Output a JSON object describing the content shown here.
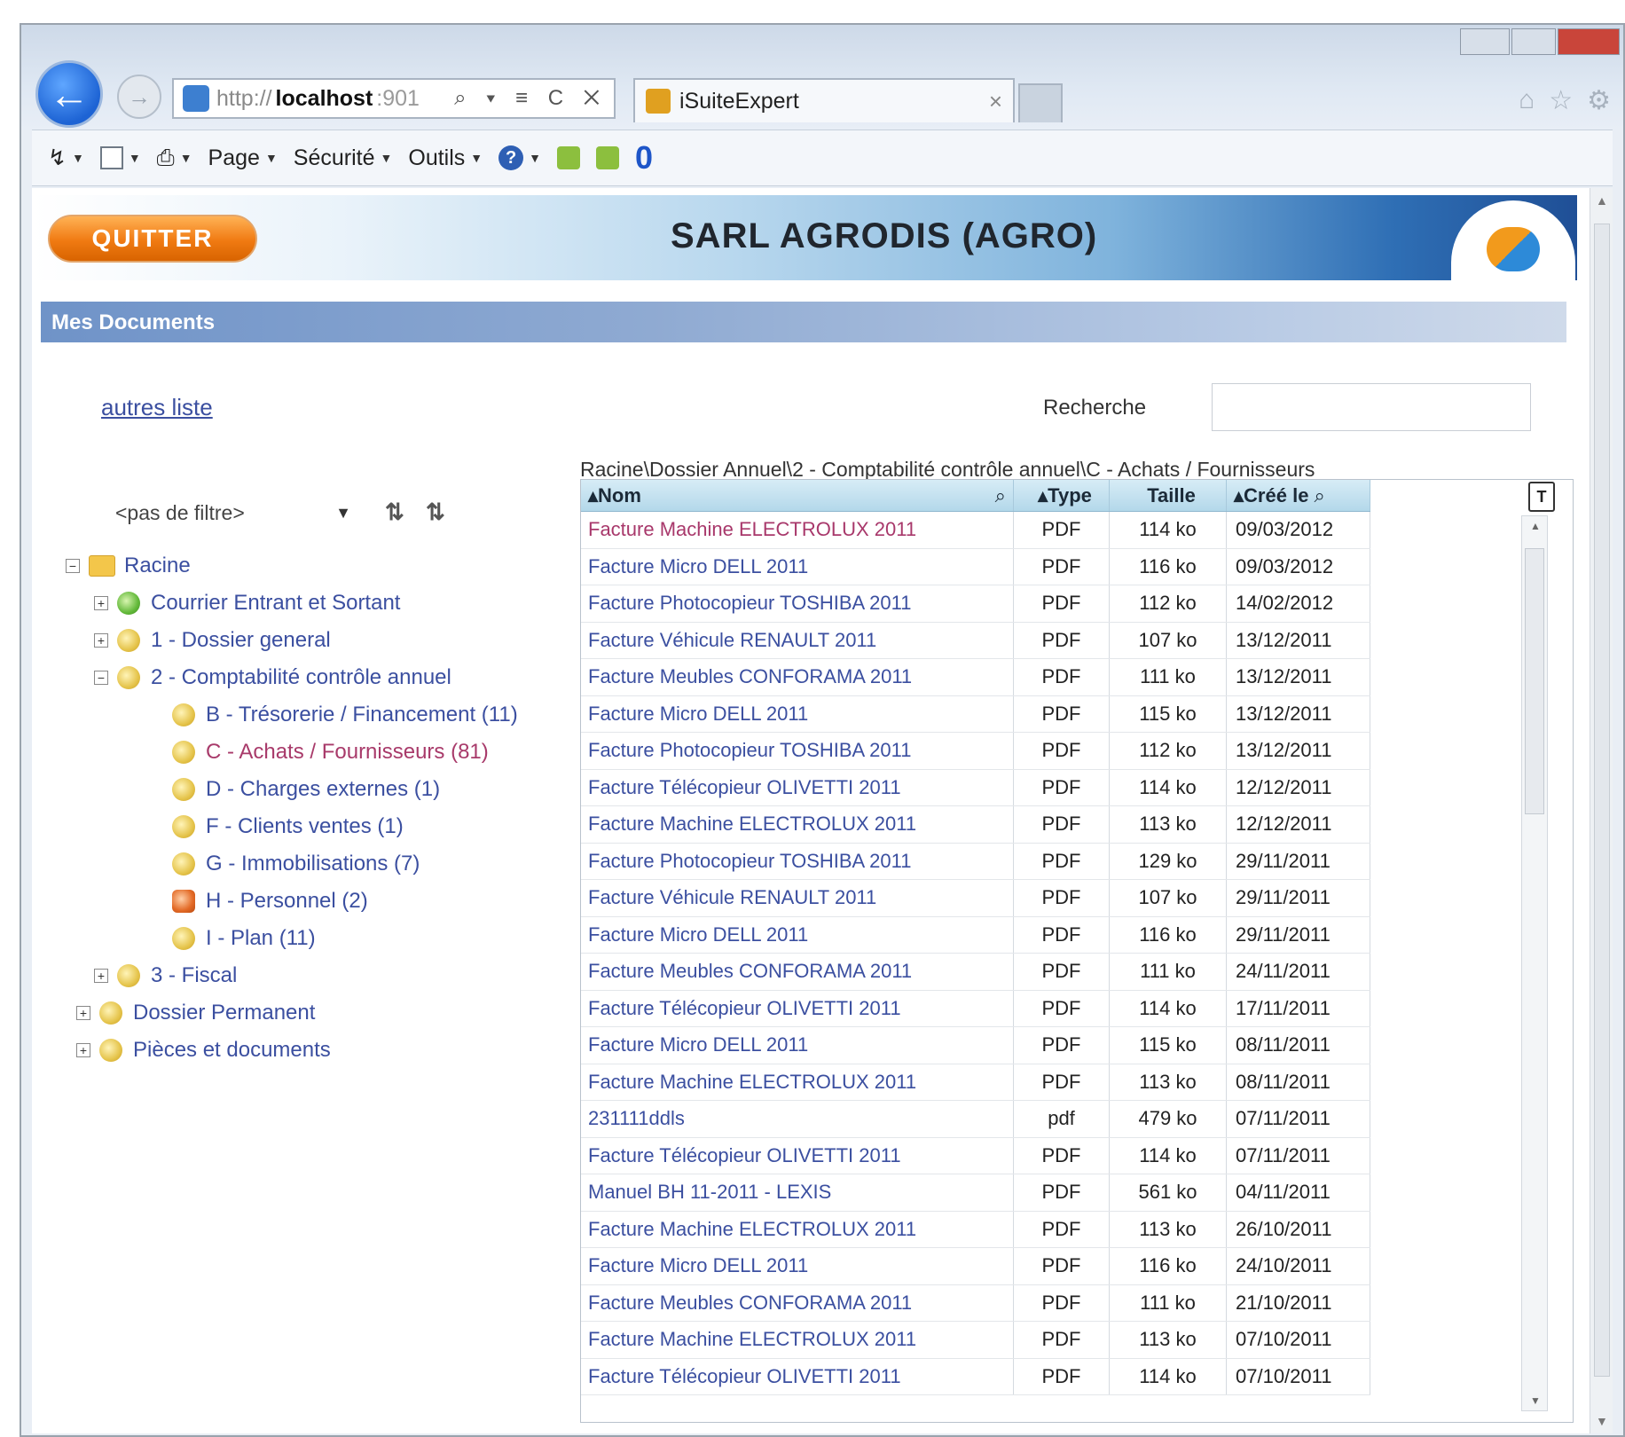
{
  "browser": {
    "url_proto": "http://",
    "url_host": "localhost",
    "url_tail": ":901",
    "address_icons": "⌕ ▾ ≡ C ✕",
    "tab_title": "iSuiteExpert",
    "tab_close": "×",
    "back_glyph": "←"
  },
  "commandbar": {
    "page_menu": "Page",
    "security_menu": "Sécurité",
    "tools_menu": "Outils",
    "caret": "▼",
    "help_glyph": "?",
    "blue_glyph": "0"
  },
  "app": {
    "quit_button": "QUITTER",
    "company_name": "SARL AGRODIS (AGRO)",
    "section_title": "Mes Documents",
    "back_link": "autres liste",
    "search_label": "Recherche",
    "search_value": "",
    "breadcrumb": "Racine\\Dossier Annuel\\2 - Comptabilité contrôle annuel\\C - Achats / Fournisseurs"
  },
  "tree": {
    "filter_value": "<pas de filtre>",
    "filter_caret": "▼",
    "tool_1": "⇅",
    "tool_2": "⇅",
    "nodes": [
      {
        "label": "Racine",
        "toggle": "−"
      },
      {
        "label": "Courrier Entrant et Sortant",
        "toggle": "+"
      },
      {
        "label": "1 - Dossier general",
        "toggle": "+"
      },
      {
        "label": "2 - Comptabilité contrôle annuel",
        "toggle": "−"
      },
      {
        "label": "B - Trésorerie / Financement (11)",
        "toggle": ""
      },
      {
        "label": "C - Achats / Fournisseurs (81)",
        "toggle": ""
      },
      {
        "label": "D - Charges externes (1)",
        "toggle": ""
      },
      {
        "label": "F - Clients ventes (1)",
        "toggle": ""
      },
      {
        "label": "G - Immobilisations (7)",
        "toggle": ""
      },
      {
        "label": "H - Personnel (2)",
        "toggle": ""
      },
      {
        "label": "I - Plan (11)",
        "toggle": ""
      },
      {
        "label": "3 - Fiscal",
        "toggle": "+"
      },
      {
        "label": "Dossier Permanent",
        "toggle": "+"
      },
      {
        "label": "Pièces et documents",
        "toggle": "+"
      }
    ]
  },
  "grid": {
    "columns": [
      "▴Nom",
      "▴Type",
      "Taille",
      "▴Créé le"
    ],
    "clear_filter": "T",
    "rows": [
      {
        "name": "Facture Machine ELECTROLUX 2011",
        "type": "PDF",
        "size": "114 ko",
        "date": "09/03/2012"
      },
      {
        "name": "Facture Micro DELL 2011",
        "type": "PDF",
        "size": "116 ko",
        "date": "09/03/2012"
      },
      {
        "name": "Facture Photocopieur TOSHIBA 2011",
        "type": "PDF",
        "size": "112 ko",
        "date": "14/02/2012"
      },
      {
        "name": "Facture Véhicule RENAULT 2011",
        "type": "PDF",
        "size": "107 ko",
        "date": "13/12/2011"
      },
      {
        "name": "Facture Meubles CONFORAMA 2011",
        "type": "PDF",
        "size": "111 ko",
        "date": "13/12/2011"
      },
      {
        "name": "Facture Micro DELL 2011",
        "type": "PDF",
        "size": "115 ko",
        "date": "13/12/2011"
      },
      {
        "name": "Facture Photocopieur TOSHIBA 2011",
        "type": "PDF",
        "size": "112 ko",
        "date": "13/12/2011"
      },
      {
        "name": "Facture Télécopieur OLIVETTI 2011",
        "type": "PDF",
        "size": "114 ko",
        "date": "12/12/2011"
      },
      {
        "name": "Facture Machine ELECTROLUX 2011",
        "type": "PDF",
        "size": "113 ko",
        "date": "12/12/2011"
      },
      {
        "name": "Facture Photocopieur TOSHIBA 2011",
        "type": "PDF",
        "size": "129 ko",
        "date": "29/11/2011"
      },
      {
        "name": "Facture Véhicule RENAULT 2011",
        "type": "PDF",
        "size": "107 ko",
        "date": "29/11/2011"
      },
      {
        "name": "Facture Micro DELL 2011",
        "type": "PDF",
        "size": "116 ko",
        "date": "29/11/2011"
      },
      {
        "name": "Facture Meubles CONFORAMA 2011",
        "type": "PDF",
        "size": "111 ko",
        "date": "24/11/2011"
      },
      {
        "name": "Facture Télécopieur OLIVETTI 2011",
        "type": "PDF",
        "size": "114 ko",
        "date": "17/11/2011"
      },
      {
        "name": "Facture Micro DELL 2011",
        "type": "PDF",
        "size": "115 ko",
        "date": "08/11/2011"
      },
      {
        "name": "Facture Machine ELECTROLUX 2011",
        "type": "PDF",
        "size": "113 ko",
        "date": "08/11/2011"
      },
      {
        "name": "231111ddls",
        "type": "pdf",
        "size": "479 ko",
        "date": "07/11/2011"
      },
      {
        "name": "Facture Télécopieur OLIVETTI 2011",
        "type": "PDF",
        "size": "114 ko",
        "date": "07/11/2011"
      },
      {
        "name": "Manuel BH 11-2011 - LEXIS",
        "type": "PDF",
        "size": "561 ko",
        "date": "04/11/2011"
      },
      {
        "name": "Facture Machine ELECTROLUX 2011",
        "type": "PDF",
        "size": "113 ko",
        "date": "26/10/2011"
      },
      {
        "name": "Facture Micro DELL 2011",
        "type": "PDF",
        "size": "116 ko",
        "date": "24/10/2011"
      },
      {
        "name": "Facture Meubles CONFORAMA 2011",
        "type": "PDF",
        "size": "111 ko",
        "date": "21/10/2011"
      },
      {
        "name": "Facture Machine ELECTROLUX 2011",
        "type": "PDF",
        "size": "113 ko",
        "date": "07/10/2011"
      },
      {
        "name": "Facture Télécopieur OLIVETTI 2011",
        "type": "PDF",
        "size": "114 ko",
        "date": "07/10/2011"
      }
    ]
  }
}
